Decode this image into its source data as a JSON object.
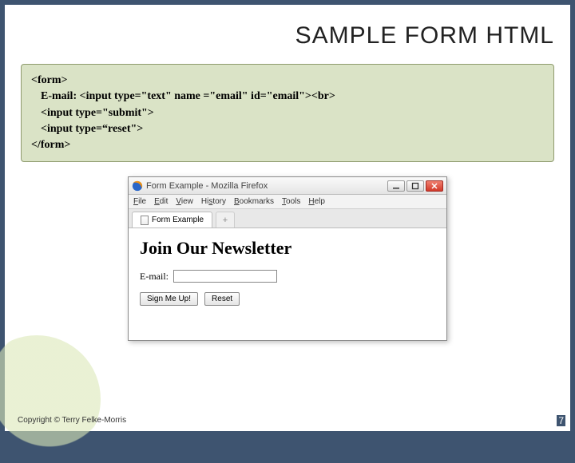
{
  "slide": {
    "title": "SAMPLE FORM HTML",
    "code": {
      "l1": "<form>",
      "l2": "E-mail: <input type=\"text\" name =\"email\"  id=\"email\"><br>",
      "l3": "<input type=\"submit\">",
      "l4": "<input type=“reset\">",
      "l5": "</form>"
    },
    "copyright": "Copyright © Terry Felke-Morris",
    "page": "7"
  },
  "browser": {
    "title": "Form Example - Mozilla Firefox",
    "menus": {
      "file": "File",
      "edit": "Edit",
      "view": "View",
      "history": "History",
      "bookmarks": "Bookmarks",
      "tools": "Tools",
      "help": "Help"
    },
    "tab_label": "Form Example",
    "plus": "+",
    "page": {
      "heading": "Join Our Newsletter",
      "email_label": "E-mail:",
      "submit_btn": "Sign Me Up!",
      "reset_btn": "Reset"
    }
  }
}
